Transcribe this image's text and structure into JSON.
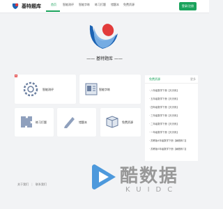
{
  "brand": {
    "name": "基特题库"
  },
  "nav": {
    "items": [
      "首页",
      "智能测评",
      "智能字练",
      "练习打题",
      "错题本",
      "免费资源"
    ],
    "active_index": 0,
    "cta": "登录/注册"
  },
  "hero": {
    "title": "—— 基特题库 ——"
  },
  "cards": [
    {
      "label": "智能测评",
      "icon": "gear-icon"
    },
    {
      "label": "智能字练",
      "icon": "book-icon"
    },
    {
      "label": "练习打题",
      "icon": "puzzle-icon"
    },
    {
      "label": "错题本",
      "icon": "pencil-icon"
    },
    {
      "label": "免费资源",
      "icon": "box-icon"
    }
  ],
  "hot_badge": "热",
  "sidebar": {
    "title": "免费资源",
    "more": "更多",
    "rows": [
      "· 八年级数学下册【天天练】",
      "· 五年级数学下册【天天练】",
      "· 四年级数学下册【天天练】",
      "· 三年级数学下册【天天练】",
      "· 二年级数学下册【天天练】",
      "· 一年级数学下册【天天练】",
      "· 苏教版4年级数学下册【暑假练习】",
      "· 苏教版5年级数学下册【暑假练习】"
    ]
  },
  "footer": {
    "links": [
      "关于我们",
      "联系我们"
    ]
  },
  "watermark": {
    "main": "酷数据",
    "sub": "KUIDC"
  },
  "colors": {
    "accent": "#1aa35c",
    "blue": "#1c63b3",
    "red": "#e23b3b"
  }
}
